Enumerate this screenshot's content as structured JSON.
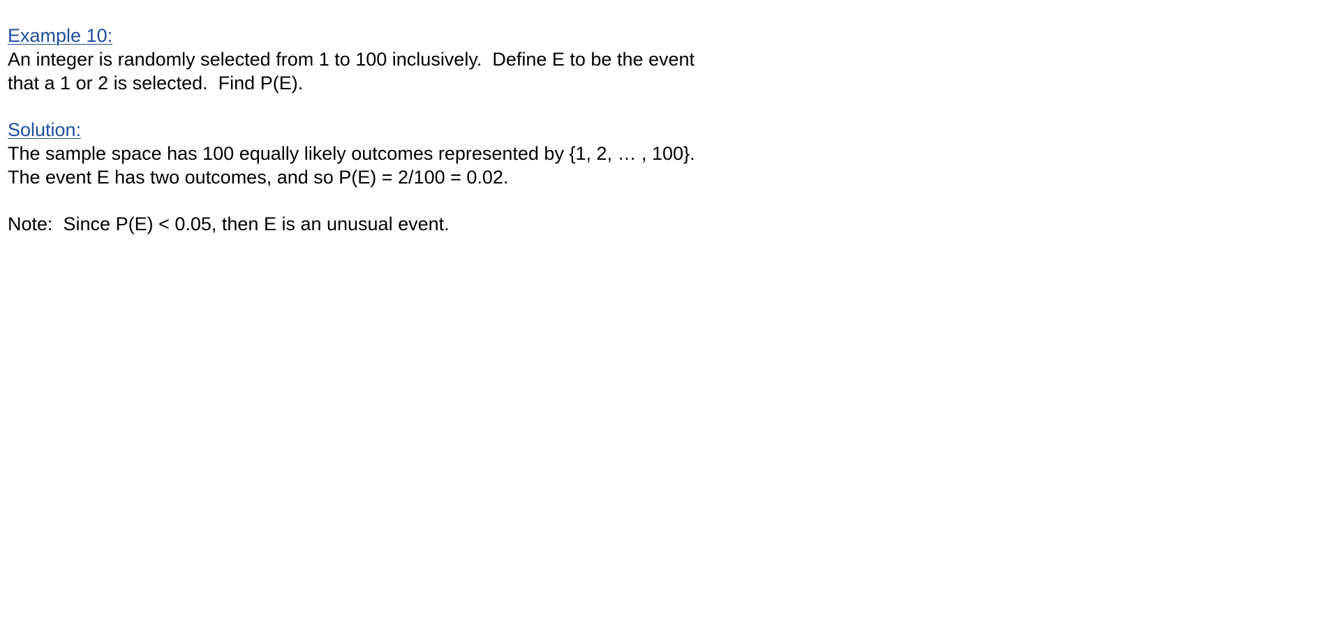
{
  "example": {
    "heading": "Example 10:",
    "lines": [
      "An integer is randomly selected from 1 to 100 inclusively.  Define E to be the event",
      "that a 1 or 2 is selected.  Find P(E)."
    ]
  },
  "solution": {
    "heading": "Solution:",
    "lines": [
      "The sample space has 100 equally likely outcomes represented by {1, 2, … , 100}.",
      "The event E has two outcomes, and so P(E) = 2/100 = 0.02."
    ]
  },
  "note": {
    "text": "Note:  Since P(E) < 0.05, then E is an unusual event."
  },
  "colors": {
    "heading": "#1f4e9c",
    "text": "#000000",
    "background": "#ffffff"
  }
}
